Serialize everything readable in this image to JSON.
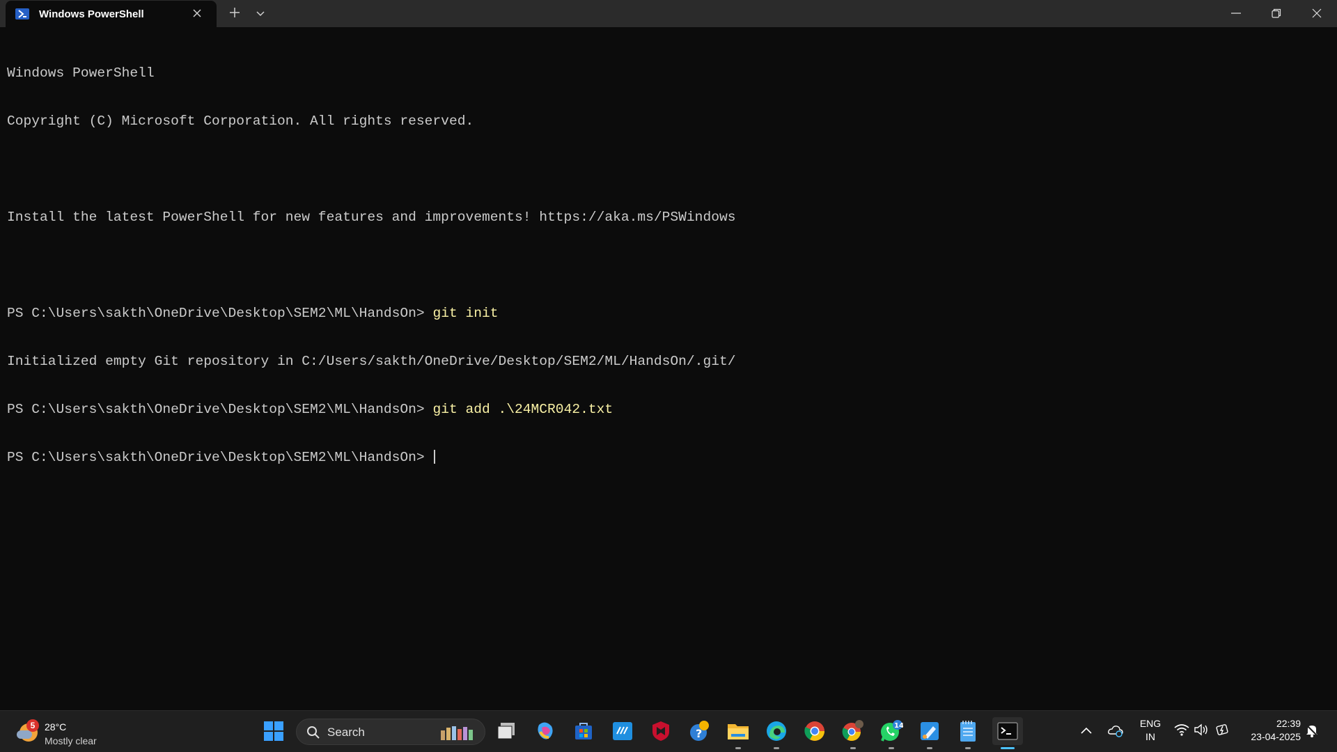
{
  "window": {
    "tab_title": "Windows PowerShell",
    "icons": {
      "tab": "powershell-icon",
      "close_tab": "close-icon",
      "new_tab": "plus-icon",
      "dropdown": "chevron-down-icon",
      "minimize": "minimize-icon",
      "maximize": "restore-icon",
      "close": "close-icon"
    }
  },
  "terminal": {
    "lines": [
      {
        "text": "Windows PowerShell"
      },
      {
        "text": "Copyright (C) Microsoft Corporation. All rights reserved."
      },
      {
        "text": ""
      },
      {
        "text": "Install the latest PowerShell for new features and improvements! https://aka.ms/PSWindows"
      },
      {
        "text": ""
      },
      {
        "prompt": "PS C:\\Users\\sakth\\OneDrive\\Desktop\\SEM2\\ML\\HandsOn> ",
        "command": "git init"
      },
      {
        "text": "Initialized empty Git repository in C:/Users/sakth/OneDrive/Desktop/SEM2/ML/HandsOn/.git/"
      },
      {
        "prompt": "PS C:\\Users\\sakth\\OneDrive\\Desktop\\SEM2\\ML\\HandsOn> ",
        "command": "git add .\\24MCR042.txt"
      },
      {
        "prompt": "PS C:\\Users\\sakth\\OneDrive\\Desktop\\SEM2\\ML\\HandsOn> ",
        "command": ""
      }
    ],
    "colors": {
      "text": "#cccccc",
      "command": "#f9f1a5",
      "background": "#0c0c0c"
    }
  },
  "taskbar": {
    "weather": {
      "badge": "5",
      "temperature": "28°C",
      "condition": "Mostly clear"
    },
    "search_label": "Search",
    "apps": [
      {
        "name": "start-icon"
      },
      {
        "name": "task-view-icon"
      },
      {
        "name": "copilot-icon"
      },
      {
        "name": "microsoft-store-icon"
      },
      {
        "name": "myhp-icon"
      },
      {
        "name": "mcafee-icon"
      },
      {
        "name": "get-help-icon"
      },
      {
        "name": "file-explorer-icon"
      },
      {
        "name": "edge-icon"
      },
      {
        "name": "chrome-icon"
      },
      {
        "name": "chrome-profile-icon"
      },
      {
        "name": "whatsapp-icon",
        "badge": "14"
      },
      {
        "name": "paint-icon"
      },
      {
        "name": "notepad-icon"
      },
      {
        "name": "terminal-icon"
      }
    ],
    "tray": {
      "lang_top": "ENG",
      "lang_bottom": "IN",
      "time": "22:39",
      "date": "23-04-2025"
    }
  }
}
